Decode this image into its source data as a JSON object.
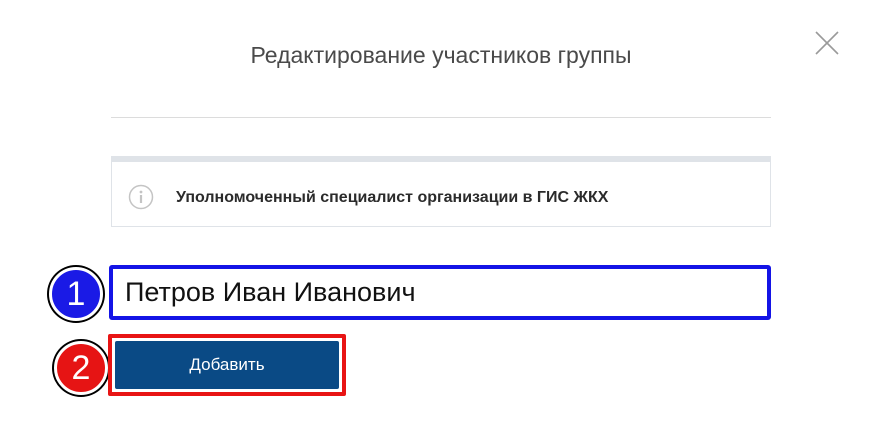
{
  "dialog": {
    "title": "Редактирование участников группы",
    "close_icon": "close-icon"
  },
  "info": {
    "icon": "info-icon",
    "text": "Уполномоченный специалист организации в ГИС ЖКХ"
  },
  "form": {
    "name_value": "Петров Иван Иванович",
    "add_label": "Добавить"
  },
  "annotations": [
    {
      "label": "1",
      "color": "#1a1ae6"
    },
    {
      "label": "2",
      "color": "#e61414"
    }
  ],
  "colors": {
    "accent": "#0a4a85",
    "input_highlight": "#1414e6",
    "button_highlight": "#e81414"
  }
}
